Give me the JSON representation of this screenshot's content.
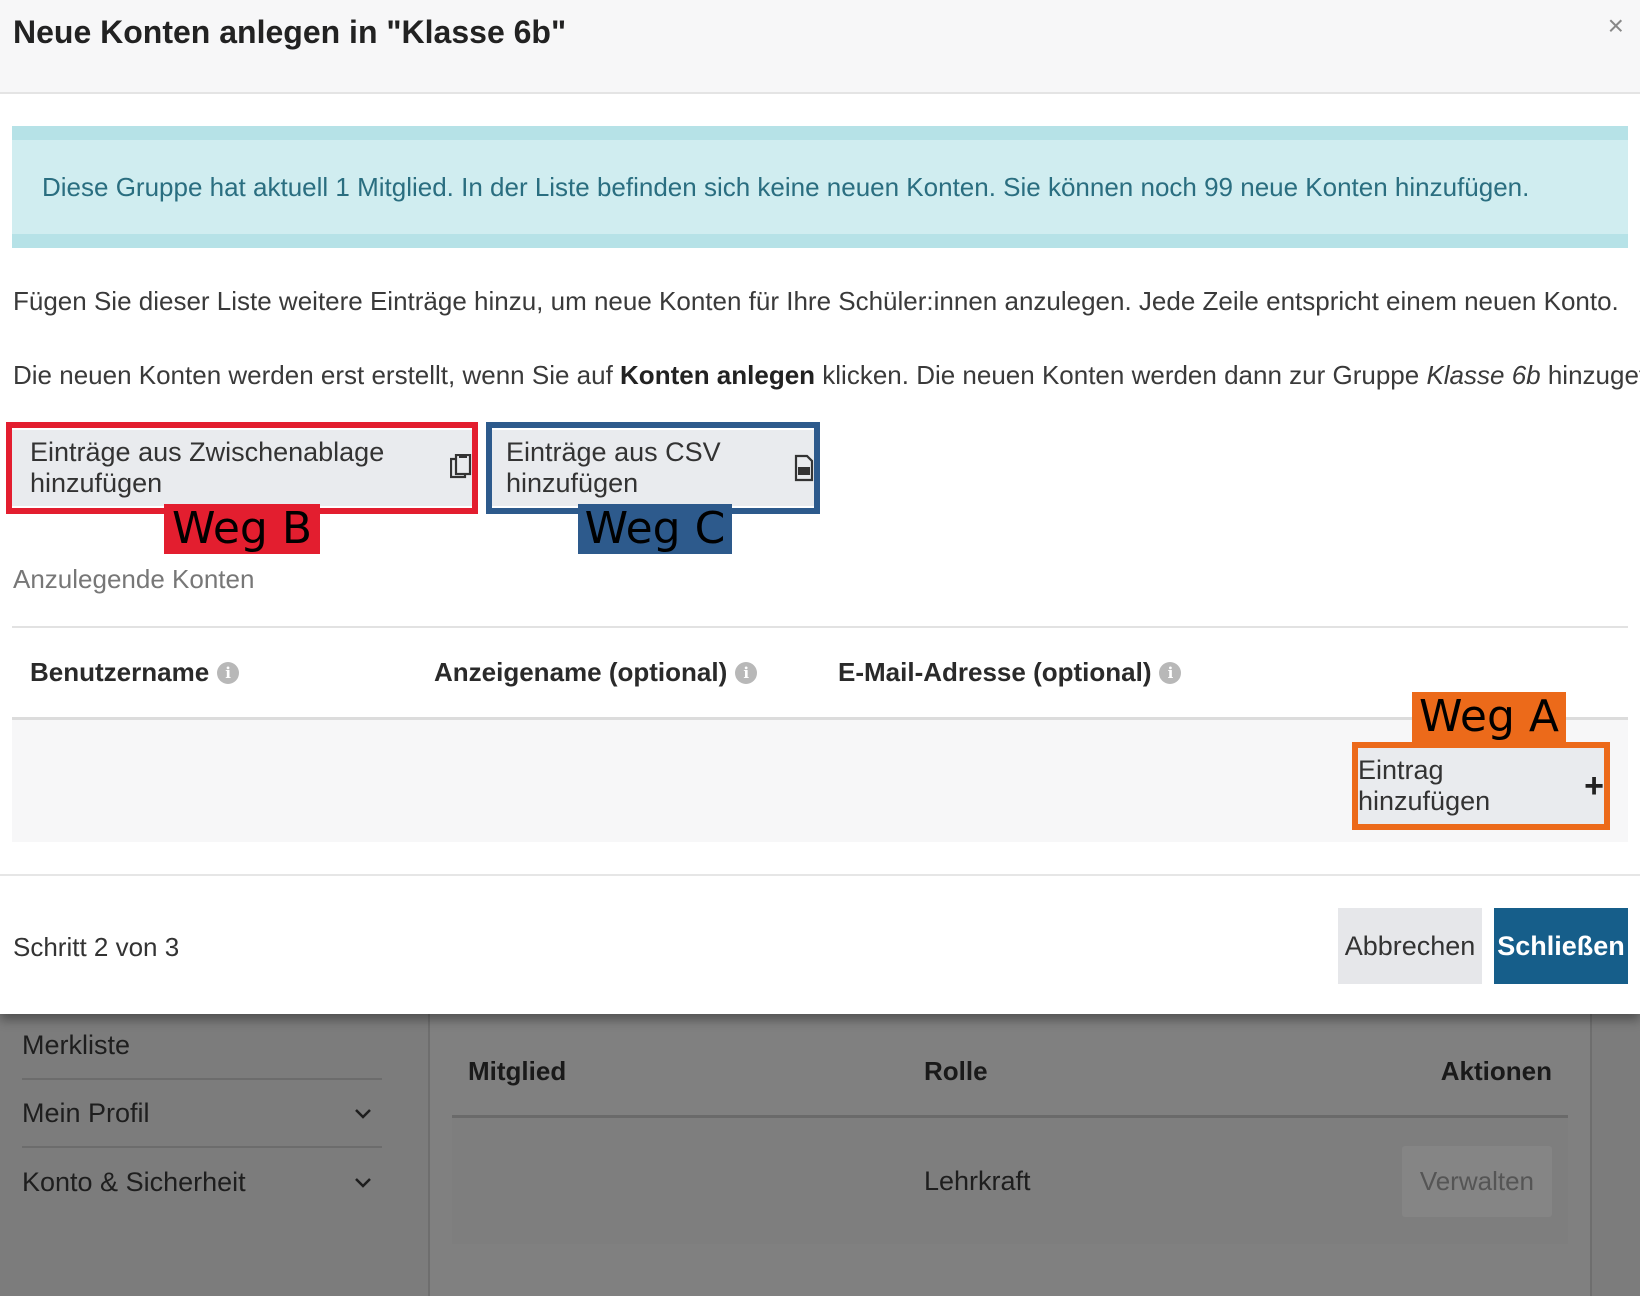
{
  "modal": {
    "title": "Neue Konten anlegen in \"Klasse 6b\"",
    "close_label": "×",
    "info_text": "Diese Gruppe hat aktuell 1 Mitglied. In der Liste befinden sich keine neuen Konten. Sie können noch 99 neue Konten hinzufügen.",
    "para1": "Fügen Sie dieser Liste weitere Einträge hinzu, um neue Konten für Ihre Schüler:innen anzulegen. Jede Zeile entspricht einem neuen Konto.",
    "para2": {
      "part1": "Die neuen Konten werden erst erstellt, wenn Sie auf ",
      "bold": "Konten anlegen",
      "part2": " klicken. Die neuen Konten werden dann zur Gruppe ",
      "italic": "Klasse 6b",
      "part3": " hinzugefügt."
    },
    "buttons": {
      "clipboard": "Einträge aus Zwischenablage hinzufügen",
      "csv": "Einträge aus CSV hinzufügen",
      "add_entry": "Eintrag hinzufügen",
      "add_entry_plus": "+"
    },
    "annotations": {
      "weg_a": "Weg A",
      "weg_b": "Weg B",
      "weg_c": "Weg C",
      "colors": {
        "weg_a": "#ec6a1a",
        "weg_b": "#e31e2f",
        "weg_c": "#2d5a8c"
      }
    },
    "section_label": "Anzulegende Konten",
    "table": {
      "columns": [
        "Benutzername",
        "Anzeigename (optional)",
        "E-Mail-Adresse (optional)"
      ],
      "info_icon": "i"
    },
    "footer": {
      "step": "Schritt 2 von 3",
      "cancel": "Abbrechen",
      "close": "Schließen"
    }
  },
  "background": {
    "sidebar": [
      {
        "label": "Merkliste",
        "chevron": ""
      },
      {
        "label": "Mein Profil",
        "chevron": "⌄"
      },
      {
        "label": "Konto & Sicherheit",
        "chevron": "⌄"
      }
    ],
    "table": {
      "headers": [
        "Mitglied",
        "Rolle",
        "Aktionen"
      ],
      "rows": [
        {
          "member": "",
          "role": "Lehrkraft",
          "action": "Verwalten"
        }
      ]
    }
  },
  "colors": {
    "primary": "#165e8a",
    "info_bg": "#d0edf0",
    "info_text": "#2a6e80"
  }
}
